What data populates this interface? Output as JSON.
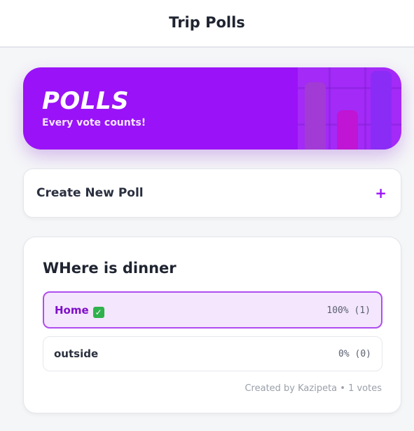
{
  "header": {
    "title": "Trip Polls"
  },
  "hero": {
    "title": "POLLS",
    "subtitle": "Every vote counts!",
    "accent": "#9a12f7"
  },
  "create": {
    "label": "Create New Poll",
    "icon": "plus-icon",
    "icon_glyph": "+"
  },
  "poll": {
    "question": "WHere is dinner",
    "options": [
      {
        "label": "Home",
        "result": "100% (1)",
        "selected": true,
        "check_glyph": "✓"
      },
      {
        "label": "outside",
        "result": "0% (0)",
        "selected": false
      }
    ],
    "footer": "Created by Kazipeta • 1 votes"
  }
}
